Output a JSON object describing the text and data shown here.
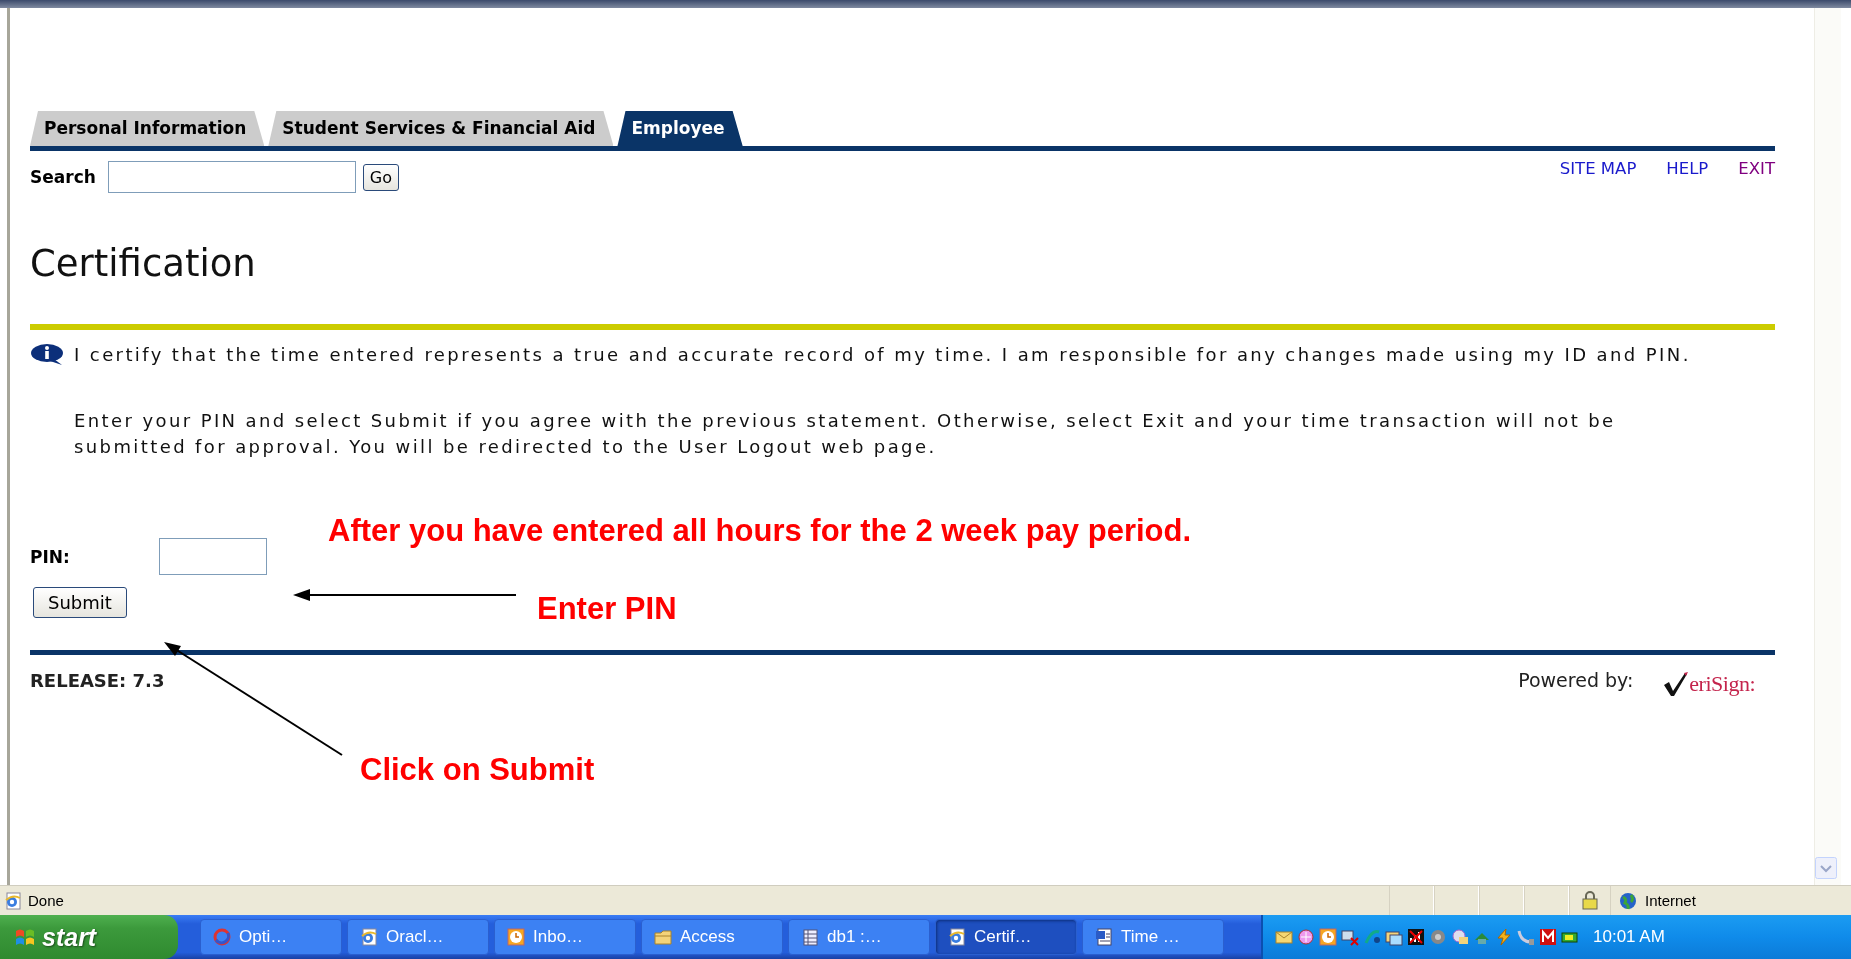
{
  "tabs": [
    {
      "label": "Personal Information",
      "selected": false
    },
    {
      "label": "Student Services & Financial Aid",
      "selected": false
    },
    {
      "label": "Employee",
      "selected": true
    }
  ],
  "search": {
    "label": "Search",
    "button": "Go"
  },
  "top_links": [
    {
      "label": "SITE MAP",
      "visited": false
    },
    {
      "label": "HELP",
      "visited": false
    },
    {
      "label": "EXIT",
      "visited": true
    }
  ],
  "page_title": "Certification",
  "info_paragraphs": [
    "I certify that the time entered represents a true and accurate record of my time. I am responsible for any changes made using my ID and PIN.",
    "Enter your PIN and select Submit if you agree with the previous statement. Otherwise, select Exit and your time transaction will not be submitted for approval. You will be redirected to the User Logout web page."
  ],
  "pin": {
    "label": "PIN:"
  },
  "submit_button": "Submit",
  "release": "RELEASE: 7.3",
  "powered_by": "Powered by:",
  "logo": {
    "text": "eriSign:"
  },
  "annotations": [
    {
      "text": "After you have entered all hours for the 2 week pay period.",
      "kind": "note"
    },
    {
      "text": "Enter PIN",
      "kind": "pin-arrow"
    },
    {
      "text": "Click on Submit",
      "kind": "submit-arrow"
    }
  ],
  "status_bar": {
    "text": "Done",
    "zone": "Internet"
  },
  "taskbar": {
    "start": "start",
    "clock": "10:01 AM",
    "buttons": [
      {
        "label": "Opti…",
        "selected": false
      },
      {
        "label": "Oracl…",
        "selected": false
      },
      {
        "label": "Inbo…",
        "selected": false
      },
      {
        "label": "Access",
        "selected": false
      },
      {
        "label": "db1 :…",
        "selected": false
      },
      {
        "label": "Certif…",
        "selected": true
      },
      {
        "label": "Time …",
        "selected": false
      }
    ]
  }
}
